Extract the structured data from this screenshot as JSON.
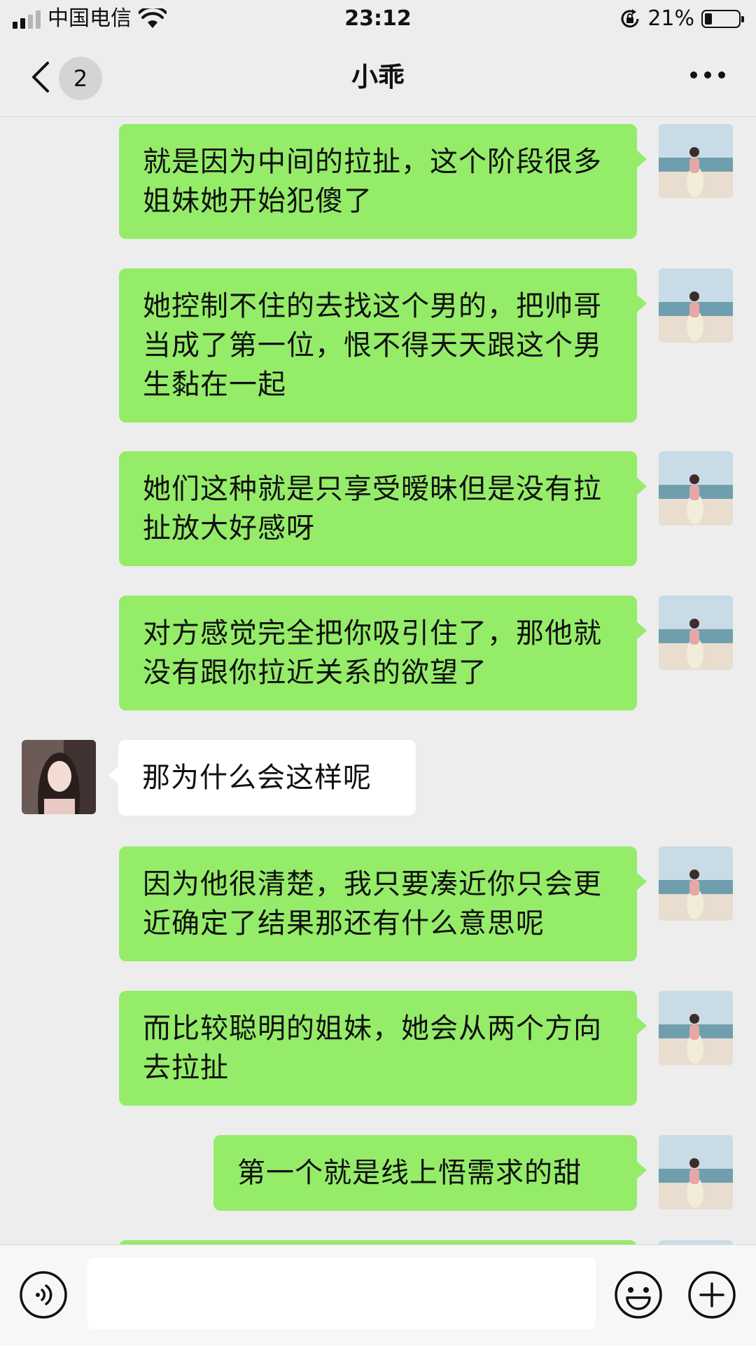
{
  "status_bar": {
    "carrier": "中国电信",
    "time": "23:12",
    "battery_percent": "21%",
    "battery_level": 0.21,
    "signal_bars": 2,
    "icons": [
      "signal-icon",
      "wifi-icon",
      "rotation-lock-icon",
      "battery-icon"
    ]
  },
  "nav": {
    "back_icon": "chevron-left-icon",
    "unread_count": "2",
    "title": "小乖",
    "more_icon": "more-dots-icon"
  },
  "messages": [
    {
      "side": "self",
      "text": "就是因为中间的拉扯，这个阶段很多姐妹她开始犯傻了"
    },
    {
      "side": "self",
      "text": "她控制不住的去找这个男的，把帅哥当成了第一位，恨不得天天跟这个男生黏在一起"
    },
    {
      "side": "self",
      "text": "她们这种就是只享受暧昧但是没有拉扯放大好感呀"
    },
    {
      "side": "self",
      "text": "对方感觉完全把你吸引住了，那他就没有跟你拉近关系的欲望了"
    },
    {
      "side": "other",
      "text": "那为什么会这样呢"
    },
    {
      "side": "self",
      "text": "因为他很清楚，我只要凑近你只会更近确定了结果那还有什么意思呢"
    },
    {
      "side": "self",
      "text": "而比较聪明的姐妹，她会从两个方向去拉扯"
    },
    {
      "side": "self",
      "text": "第一个就是线上悟需求的甜"
    }
  ],
  "input_bar": {
    "voice_icon": "voice-input-icon",
    "text_value": "",
    "emoji_icon": "emoji-icon",
    "plus_icon": "plus-circle-icon"
  },
  "colors": {
    "background": "#ededed",
    "outgoing_bubble": "#95ec69",
    "incoming_bubble": "#ffffff"
  }
}
